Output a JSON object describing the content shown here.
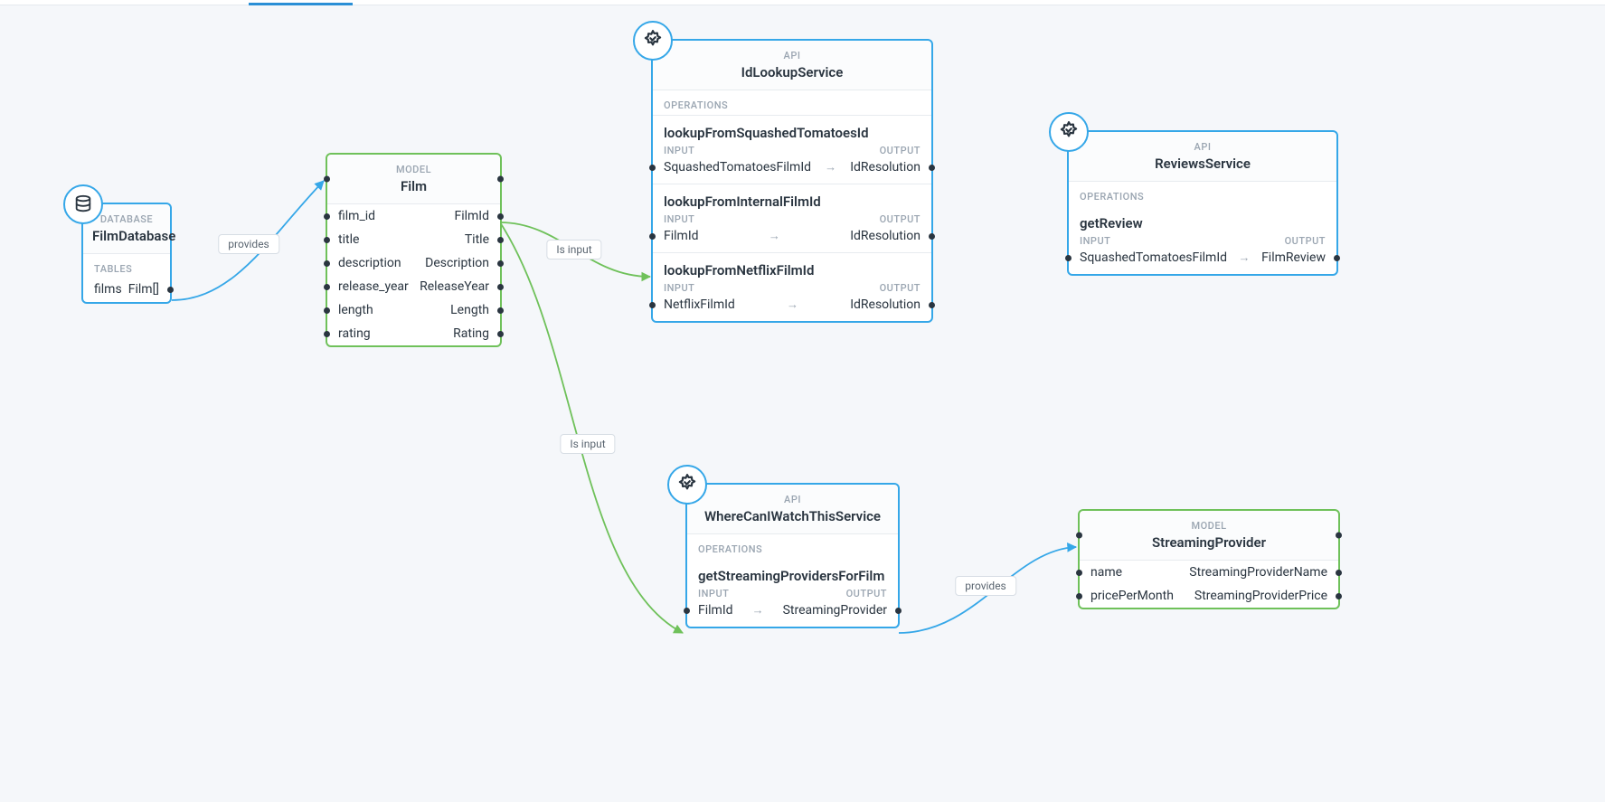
{
  "nodes": {
    "filmDatabase": {
      "kind": "DATABASE",
      "title": "FilmDatabase",
      "tablesLabel": "TABLES",
      "tables": [
        {
          "name": "films",
          "type": "Film[]"
        }
      ]
    },
    "film": {
      "kind": "MODEL",
      "title": "Film",
      "fields": [
        {
          "name": "film_id",
          "type": "FilmId"
        },
        {
          "name": "title",
          "type": "Title"
        },
        {
          "name": "description",
          "type": "Description"
        },
        {
          "name": "release_year",
          "type": "ReleaseYear"
        },
        {
          "name": "length",
          "type": "Length"
        },
        {
          "name": "rating",
          "type": "Rating"
        }
      ]
    },
    "idLookupService": {
      "kind": "API",
      "title": "IdLookupService",
      "opsLabel": "OPERATIONS",
      "inputLabel": "INPUT",
      "outputLabel": "OUTPUT",
      "operations": [
        {
          "name": "lookupFromSquashedTomatoesId",
          "input": "SquashedTomatoesFilmId",
          "output": "IdResolution"
        },
        {
          "name": "lookupFromInternalFilmId",
          "input": "FilmId",
          "output": "IdResolution"
        },
        {
          "name": "lookupFromNetflixFilmId",
          "input": "NetflixFilmId",
          "output": "IdResolution"
        }
      ]
    },
    "reviewsService": {
      "kind": "API",
      "title": "ReviewsService",
      "opsLabel": "OPERATIONS",
      "inputLabel": "INPUT",
      "outputLabel": "OUTPUT",
      "operations": [
        {
          "name": "getReview",
          "input": "SquashedTomatoesFilmId",
          "output": "FilmReview"
        }
      ]
    },
    "whereCanIWatch": {
      "kind": "API",
      "title": "WhereCanIWatchThisService",
      "opsLabel": "OPERATIONS",
      "inputLabel": "INPUT",
      "outputLabel": "OUTPUT",
      "operations": [
        {
          "name": "getStreamingProvidersForFilm",
          "input": "FilmId",
          "output": "StreamingProvider"
        }
      ]
    },
    "streamingProvider": {
      "kind": "MODEL",
      "title": "StreamingProvider",
      "fields": [
        {
          "name": "name",
          "type": "StreamingProviderName"
        },
        {
          "name": "pricePerMonth",
          "type": "StreamingProviderPrice"
        }
      ]
    }
  },
  "edges": {
    "provides1": "provides",
    "isInput1": "Is input",
    "isInput2": "Is input",
    "provides2": "provides"
  }
}
